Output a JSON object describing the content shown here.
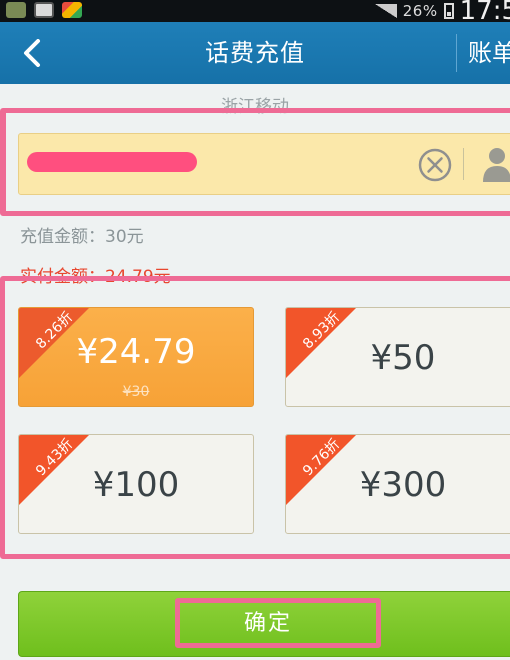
{
  "statusbar": {
    "battery": "26%",
    "time": "17:5"
  },
  "header": {
    "title": "话费充值",
    "right_link": "账单"
  },
  "carrier": "浙江移动",
  "phone": {
    "value": "",
    "clear_icon": "clear-circle-icon",
    "contact_icon": "person-icon"
  },
  "amount": {
    "label": "充值金额：",
    "value": "30元"
  },
  "pay": {
    "label": "实付金额：",
    "value": "24.79元"
  },
  "options": [
    {
      "discount": "8.26折",
      "price": "¥24.79",
      "original": "¥30",
      "selected": true
    },
    {
      "discount": "8.93折",
      "price": "¥50",
      "selected": false
    },
    {
      "discount": "9.43折",
      "price": "¥100",
      "selected": false
    },
    {
      "discount": "9.76折",
      "price": "¥300",
      "selected": false
    }
  ],
  "confirm_label": "确定",
  "colors": {
    "header": "#1a77ae",
    "field": "#fbe8aa",
    "accent": "#f7a237",
    "corner": "#f2552a",
    "button": "#7cc62a",
    "highlight": "#ee6b95"
  }
}
